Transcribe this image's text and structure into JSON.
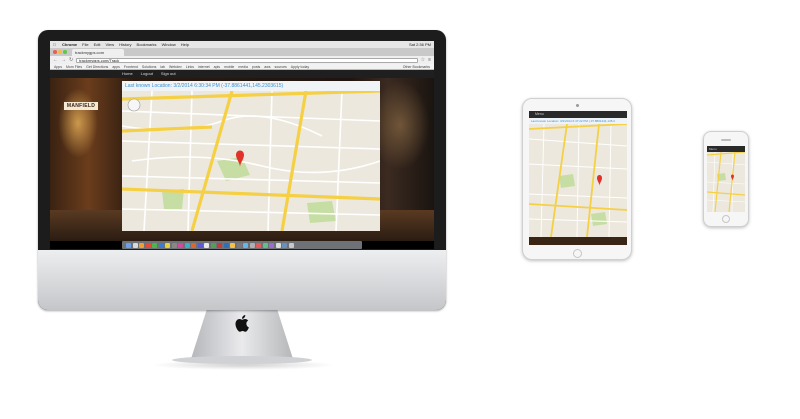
{
  "devices": {
    "desktop": {
      "mac_menubar": {
        "app_name": "Chrome",
        "items": [
          "File",
          "Edit",
          "View",
          "History",
          "Bookmarks",
          "Window",
          "Help"
        ],
        "clock": "Sat 2:36 PM"
      },
      "browser": {
        "tab_title": "trackmygps.com",
        "url": "trackmygps.com/Track",
        "bookmarks": [
          "Apps",
          "Mom Files",
          "Get Directions",
          "apps",
          "Frontend",
          "Solutions",
          "lab",
          "Webdev",
          "Links",
          "internet",
          "apis",
          "mobile",
          "media",
          "posts",
          "aws",
          "sources",
          "Apply today",
          "Other Bookmarks"
        ]
      },
      "site_nav": [
        "Home",
        "Logout",
        "Sign out"
      ],
      "storefront_sign": "MANFIELD",
      "location_text": "Last known Location: 3/2/2014 6:30:34 PM (-37.8861441,145.2303615)"
    },
    "tablet": {
      "nav_label": "Menu",
      "location_text": "Last known Location: 3/2/2014 6:47:22 PM (-37.8861441,145.2"
    },
    "phone": {
      "nav_label": "Menu"
    }
  },
  "colors": {
    "map_road_major": "#f5d045",
    "map_road_minor": "#ffffff",
    "map_land": "#ece8dd",
    "map_park": "#c6dea3",
    "map_water": "#a8c8f0",
    "pin": "#e0322b",
    "location_text": "#3c8fd0"
  },
  "icons": {
    "pin": "map-pin-icon",
    "apple": "apple-logo-icon",
    "pan": "pan-control-icon"
  }
}
